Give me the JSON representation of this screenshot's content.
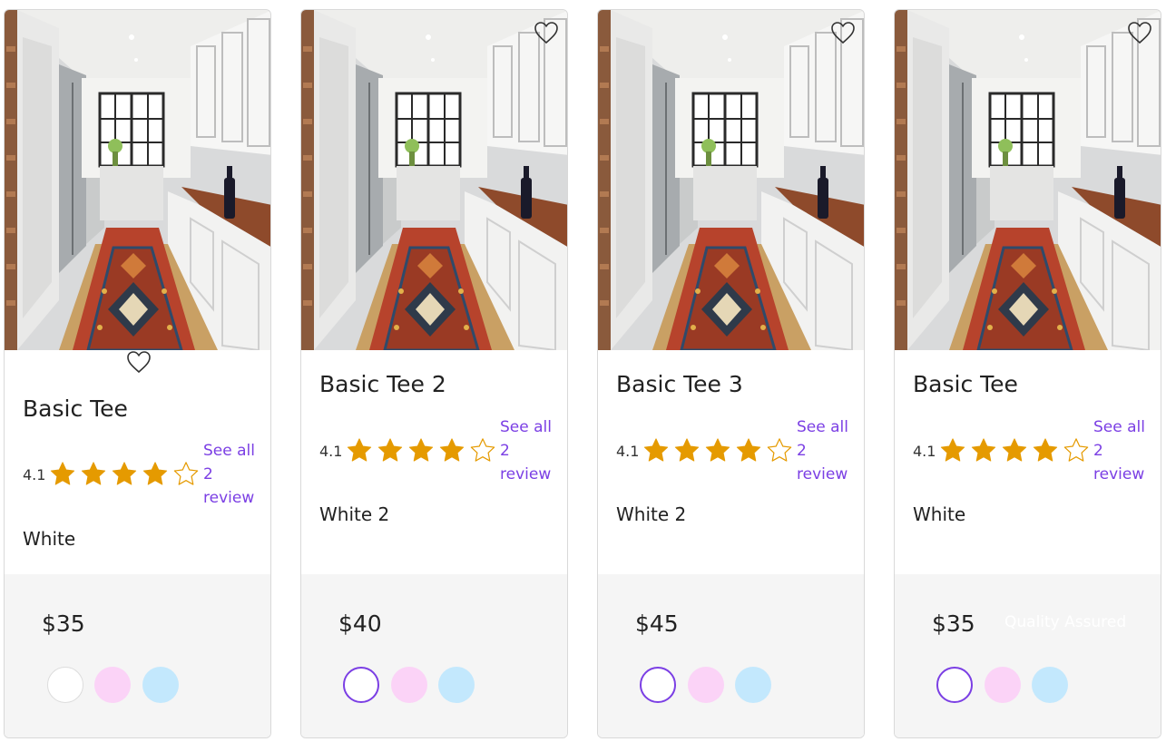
{
  "colors": {
    "accent": "#7b3fe4",
    "star": "#e59a00",
    "bottom_bg": "#f5f5f5",
    "swatch_white": "#ffffff",
    "swatch_pink": "#fbd3f7",
    "swatch_blue": "#c3e8fd"
  },
  "products": [
    {
      "title": "Basic Tee",
      "rating": "4.1",
      "stars_filled": 4,
      "stars_total": 5,
      "review_text": "See all 2 review",
      "color": "White",
      "price": "$35",
      "selected_swatch": "white",
      "icons": {
        "wishlist": "heart-outline-icon",
        "star": "star-icon"
      }
    },
    {
      "title": "Basic Tee 2",
      "rating": "4.1",
      "stars_filled": 4,
      "stars_total": 5,
      "review_text": "See all 2 review",
      "color": "White 2",
      "price": "$40",
      "selected_swatch": "white",
      "icons": {
        "wishlist": "heart-outline-icon",
        "star": "star-icon"
      }
    },
    {
      "title": "Basic Tee 3",
      "rating": "4.1",
      "stars_filled": 4,
      "stars_total": 5,
      "review_text": "See all 2 review",
      "color": "White 2",
      "price": "$45",
      "selected_swatch": "white",
      "icons": {
        "wishlist": "heart-outline-icon",
        "star": "star-icon"
      }
    },
    {
      "title": "Basic Tee",
      "rating": "4.1",
      "stars_filled": 4,
      "stars_total": 5,
      "review_text": "See all 2 review",
      "color": "White",
      "price": "$35",
      "selected_swatch": "white",
      "quality_text": "Quality Assured",
      "icons": {
        "wishlist": "heart-outline-icon",
        "star": "star-icon"
      }
    }
  ]
}
